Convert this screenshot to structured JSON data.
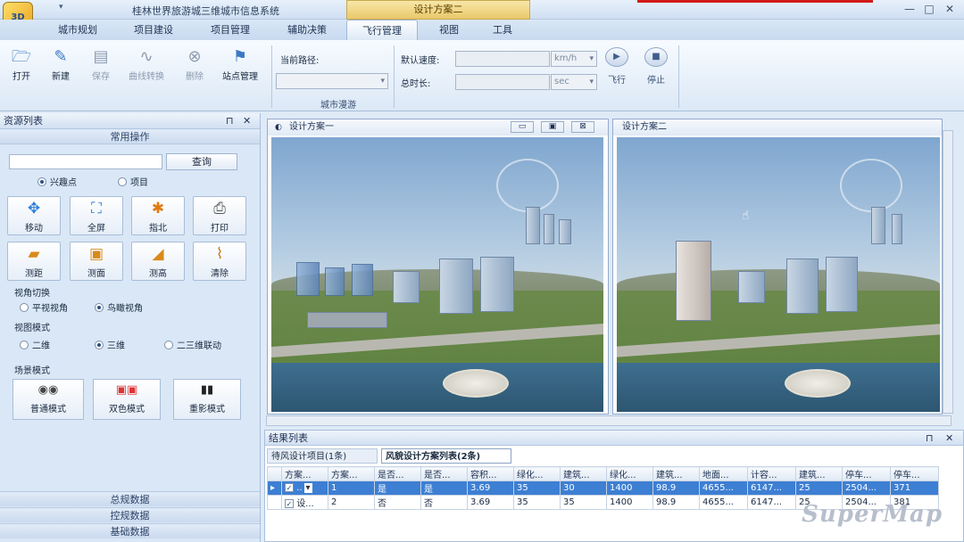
{
  "app": {
    "title": "桂林世界旅游城三维城市信息系统",
    "context_tab": "设计方案二",
    "icon_text": "3D"
  },
  "window_controls": {
    "minimize": "—",
    "restore": "□",
    "close": "✕"
  },
  "tabs": [
    "城市规划",
    "项目建设",
    "项目管理",
    "辅助决策",
    "飞行管理",
    "视图",
    "工具"
  ],
  "ribbon": {
    "buttons": [
      {
        "label": "打开",
        "icon": "open-icon",
        "glyph": "🗁"
      },
      {
        "label": "新建",
        "icon": "new-icon",
        "glyph": "✎"
      },
      {
        "label": "保存",
        "icon": "save-icon",
        "glyph": "▤"
      },
      {
        "label": "曲线转换",
        "icon": "curve-icon",
        "glyph": "∿"
      },
      {
        "label": "删除",
        "icon": "delete-icon",
        "glyph": "⊗"
      },
      {
        "label": "站点管理",
        "icon": "station-icon",
        "glyph": "⚑"
      }
    ],
    "current_path_label": "当前路径:",
    "default_speed_label": "默认速度:",
    "total_time_label": "总时长:",
    "speed_unit": "km/h",
    "time_unit": "sec",
    "fly_label": "飞行",
    "stop_label": "停止",
    "fly_glyph": "▶",
    "stop_glyph": "■",
    "group_label": "城市漫游"
  },
  "left_panel": {
    "title": "资源列表",
    "pin": "⊓",
    "close": "✕",
    "common_ops": "常用操作",
    "search_button": "查询",
    "search_types": [
      "兴趣点",
      "项目"
    ],
    "tools": [
      {
        "label": "移动",
        "icon": "move-icon",
        "glyph": "✥",
        "color": "#2f7fd6"
      },
      {
        "label": "全屏",
        "icon": "fullscreen-icon",
        "glyph": "⛶",
        "color": "#2f7fd6"
      },
      {
        "label": "指北",
        "icon": "compass-icon",
        "glyph": "✱",
        "color": "#e07b10"
      },
      {
        "label": "打印",
        "icon": "print-icon",
        "glyph": "⎙",
        "color": "#555555"
      },
      {
        "label": "测距",
        "icon": "ruler-icon",
        "glyph": "▰",
        "color": "#d98a1a"
      },
      {
        "label": "测面",
        "icon": "area-icon",
        "glyph": "▣",
        "color": "#d98a1a"
      },
      {
        "label": "测高",
        "icon": "height-icon",
        "glyph": "◢",
        "color": "#d98a1a"
      },
      {
        "label": "清除",
        "icon": "broom-icon",
        "glyph": "⌇",
        "color": "#c07a18"
      }
    ],
    "view_switch_title": "视角切换",
    "view_switch": [
      "平视视角",
      "鸟瞰视角"
    ],
    "view_mode_title": "视图模式",
    "view_mode": [
      "二维",
      "三维",
      "二三维联动"
    ],
    "scene_mode_title": "场景模式",
    "scene_modes": [
      {
        "label": "普通模式",
        "icon": "glasses-icon",
        "glyph": "◉◉"
      },
      {
        "label": "双色模式",
        "icon": "red-blue-glasses-icon",
        "glyph": "▣▣"
      },
      {
        "label": "重影模式",
        "icon": "3d-glasses-icon",
        "glyph": "▮▮"
      }
    ],
    "bottom_sections": [
      "总规数据",
      "控规数据",
      "基础数据"
    ]
  },
  "views": [
    {
      "title": "设计方案一",
      "controls": [
        "▭",
        "▣",
        "⊠"
      ]
    },
    {
      "title": "设计方案二"
    }
  ],
  "results": {
    "title": "结果列表",
    "pin": "⊓",
    "close": "✕",
    "tabs": [
      "待风设计项目(1条)",
      "风貌设计方案列表(2条)"
    ],
    "columns": [
      "方案...",
      "方案...",
      "是否...",
      "是否...",
      "容积...",
      "绿化...",
      "建筑...",
      "绿化...",
      "建筑...",
      "地面...",
      "计容...",
      "建筑...",
      "停车...",
      "停车..."
    ],
    "rows": [
      [
        " ..",
        "1",
        "是",
        "是",
        "3.69",
        "35",
        "30",
        "1400",
        "98.9",
        "4655...",
        "6147...",
        "25",
        "2504...",
        "371"
      ],
      [
        "设...",
        "2",
        "否",
        "否",
        "3.69",
        "35",
        "35",
        "1400",
        "98.9",
        "4655...",
        "6147...",
        "25",
        "2504...",
        "381"
      ]
    ]
  },
  "watermark": "SuperMap"
}
